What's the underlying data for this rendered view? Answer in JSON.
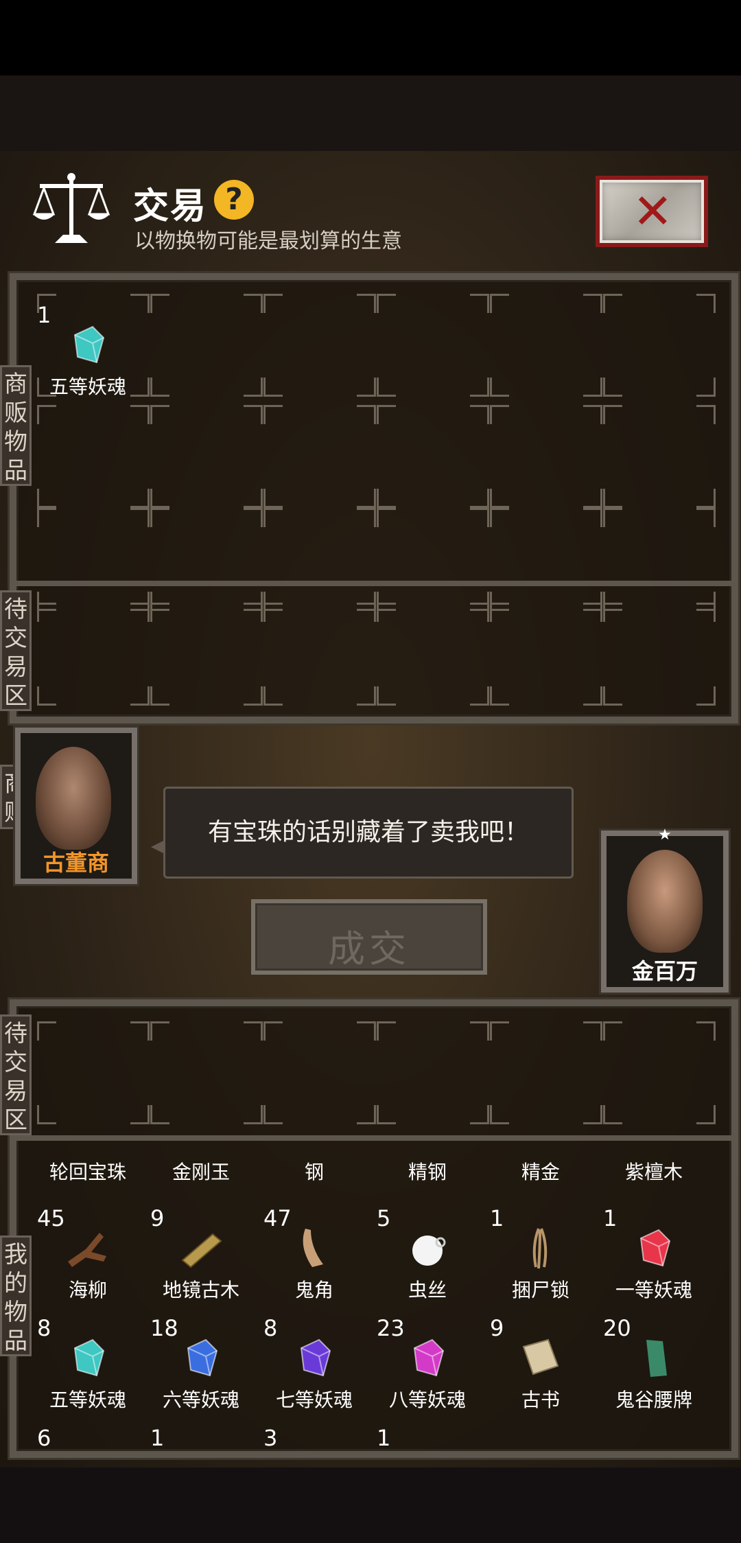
{
  "header": {
    "title": "交易",
    "help_icon": "?",
    "subtitle": "以物换物可能是最划算的生意",
    "close_icon": "✕"
  },
  "labels": {
    "merchant_goods": "商\n贩\n物\n品",
    "pending_trade_top": "待\n交\n易\n区",
    "merchant": "商\n贩",
    "pending_trade_bottom": "待\n交\n易\n区",
    "my_items": "我\n的\n物\n品"
  },
  "merchant": {
    "name": "古董商",
    "speech": "有宝珠的话别藏着了卖我吧！"
  },
  "player": {
    "name": "金百万",
    "star": "★"
  },
  "deal_button": "成交",
  "merchant_goods": [
    {
      "count": "1",
      "name": "五等妖魂",
      "icon": "soul-crystal-icon",
      "color": "#3fc7c2"
    }
  ],
  "my_items_partial_row": [
    {
      "name": "轮回宝珠"
    },
    {
      "name": "金刚玉"
    },
    {
      "name": "钢"
    },
    {
      "name": "精钢"
    },
    {
      "name": "精金"
    },
    {
      "name": "紫檀木"
    }
  ],
  "my_items": [
    {
      "count": "45",
      "name": "海柳",
      "icon": "driftwood-icon",
      "color": "#7a4a2a"
    },
    {
      "count": "9",
      "name": "地镜古木",
      "icon": "wood-plank-icon",
      "color": "#b89a4c"
    },
    {
      "count": "47",
      "name": "鬼角",
      "icon": "horn-icon",
      "color": "#c8a078"
    },
    {
      "count": "5",
      "name": "虫丝",
      "icon": "silk-bowl-icon",
      "color": "#f4f4f4"
    },
    {
      "count": "1",
      "name": "捆尸锁",
      "icon": "rope-icon",
      "color": "#b8956a"
    },
    {
      "count": "1",
      "name": "一等妖魂",
      "icon": "soul-crystal-icon",
      "color": "#e8354a"
    },
    {
      "count": "8",
      "name": "五等妖魂",
      "icon": "soul-crystal-icon",
      "color": "#3fc7c2"
    },
    {
      "count": "18",
      "name": "六等妖魂",
      "icon": "soul-crystal-icon",
      "color": "#3a6ee0"
    },
    {
      "count": "8",
      "name": "七等妖魂",
      "icon": "soul-crystal-icon",
      "color": "#6a3ad8"
    },
    {
      "count": "23",
      "name": "八等妖魂",
      "icon": "soul-crystal-icon",
      "color": "#d43ac8"
    },
    {
      "count": "9",
      "name": "古书",
      "icon": "book-icon",
      "color": "#d8c8a4"
    },
    {
      "count": "20",
      "name": "鬼谷腰牌",
      "icon": "jade-token-icon",
      "color": "#3a8a6a"
    },
    {
      "count": "6",
      "name": "",
      "icon": "",
      "color": ""
    },
    {
      "count": "1",
      "name": "",
      "icon": "",
      "color": ""
    },
    {
      "count": "3",
      "name": "",
      "icon": "",
      "color": ""
    },
    {
      "count": "1",
      "name": "",
      "icon": "",
      "color": ""
    }
  ]
}
